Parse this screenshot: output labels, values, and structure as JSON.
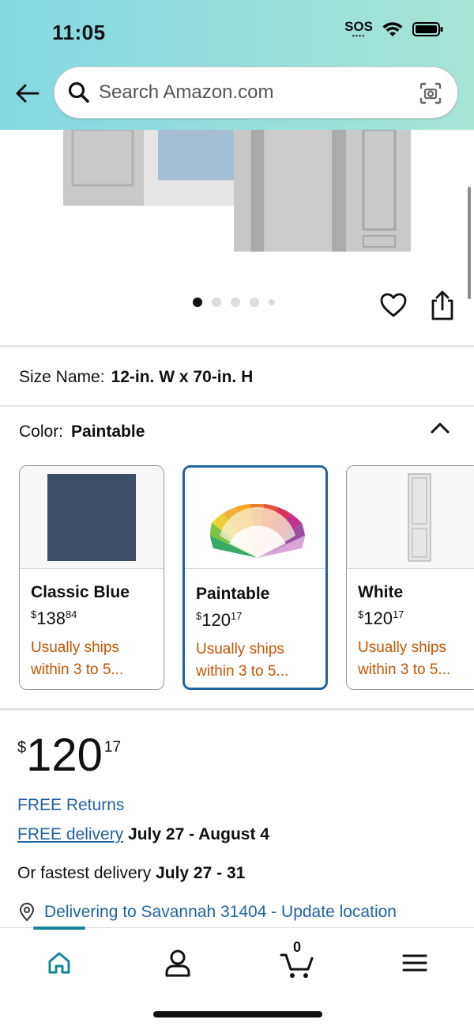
{
  "status_bar": {
    "time": "11:05",
    "carrier": "SOS"
  },
  "search": {
    "placeholder": "Search Amazon.com"
  },
  "gallery": {
    "image_count": 5,
    "active_index": 0
  },
  "size": {
    "label": "Size Name:",
    "value": "12-in. W x 70-in. H"
  },
  "color": {
    "label": "Color:",
    "value": "Paintable",
    "options": [
      {
        "name": "Classic Blue",
        "currency": "$",
        "whole": "138",
        "fraction": "84",
        "ships": "Usually ships within 3 to 5...",
        "swatch_color": "#3d4f66"
      },
      {
        "name": "Paintable",
        "currency": "$",
        "whole": "120",
        "fraction": "17",
        "ships": "Usually ships within 3 to 5...",
        "selected": true
      },
      {
        "name": "White",
        "currency": "$",
        "whole": "120",
        "fraction": "17",
        "ships": "Usually ships within 3 to 5..."
      }
    ]
  },
  "price": {
    "currency": "$",
    "whole": "120",
    "fraction": "17"
  },
  "returns": {
    "text": "FREE Returns"
  },
  "delivery": {
    "link": "FREE delivery",
    "dates": "July 27 - August 4"
  },
  "fastest": {
    "label": "Or fastest delivery",
    "dates": "July 27 - 31"
  },
  "location": {
    "text": "Delivering to Savannah 31404 - Update location"
  },
  "tabbar": {
    "cart_count": "0"
  },
  "colors": {
    "link": "#2162a1",
    "ships": "#c45500",
    "selected_border": "#2162a1",
    "tab_accent": "#138797"
  }
}
